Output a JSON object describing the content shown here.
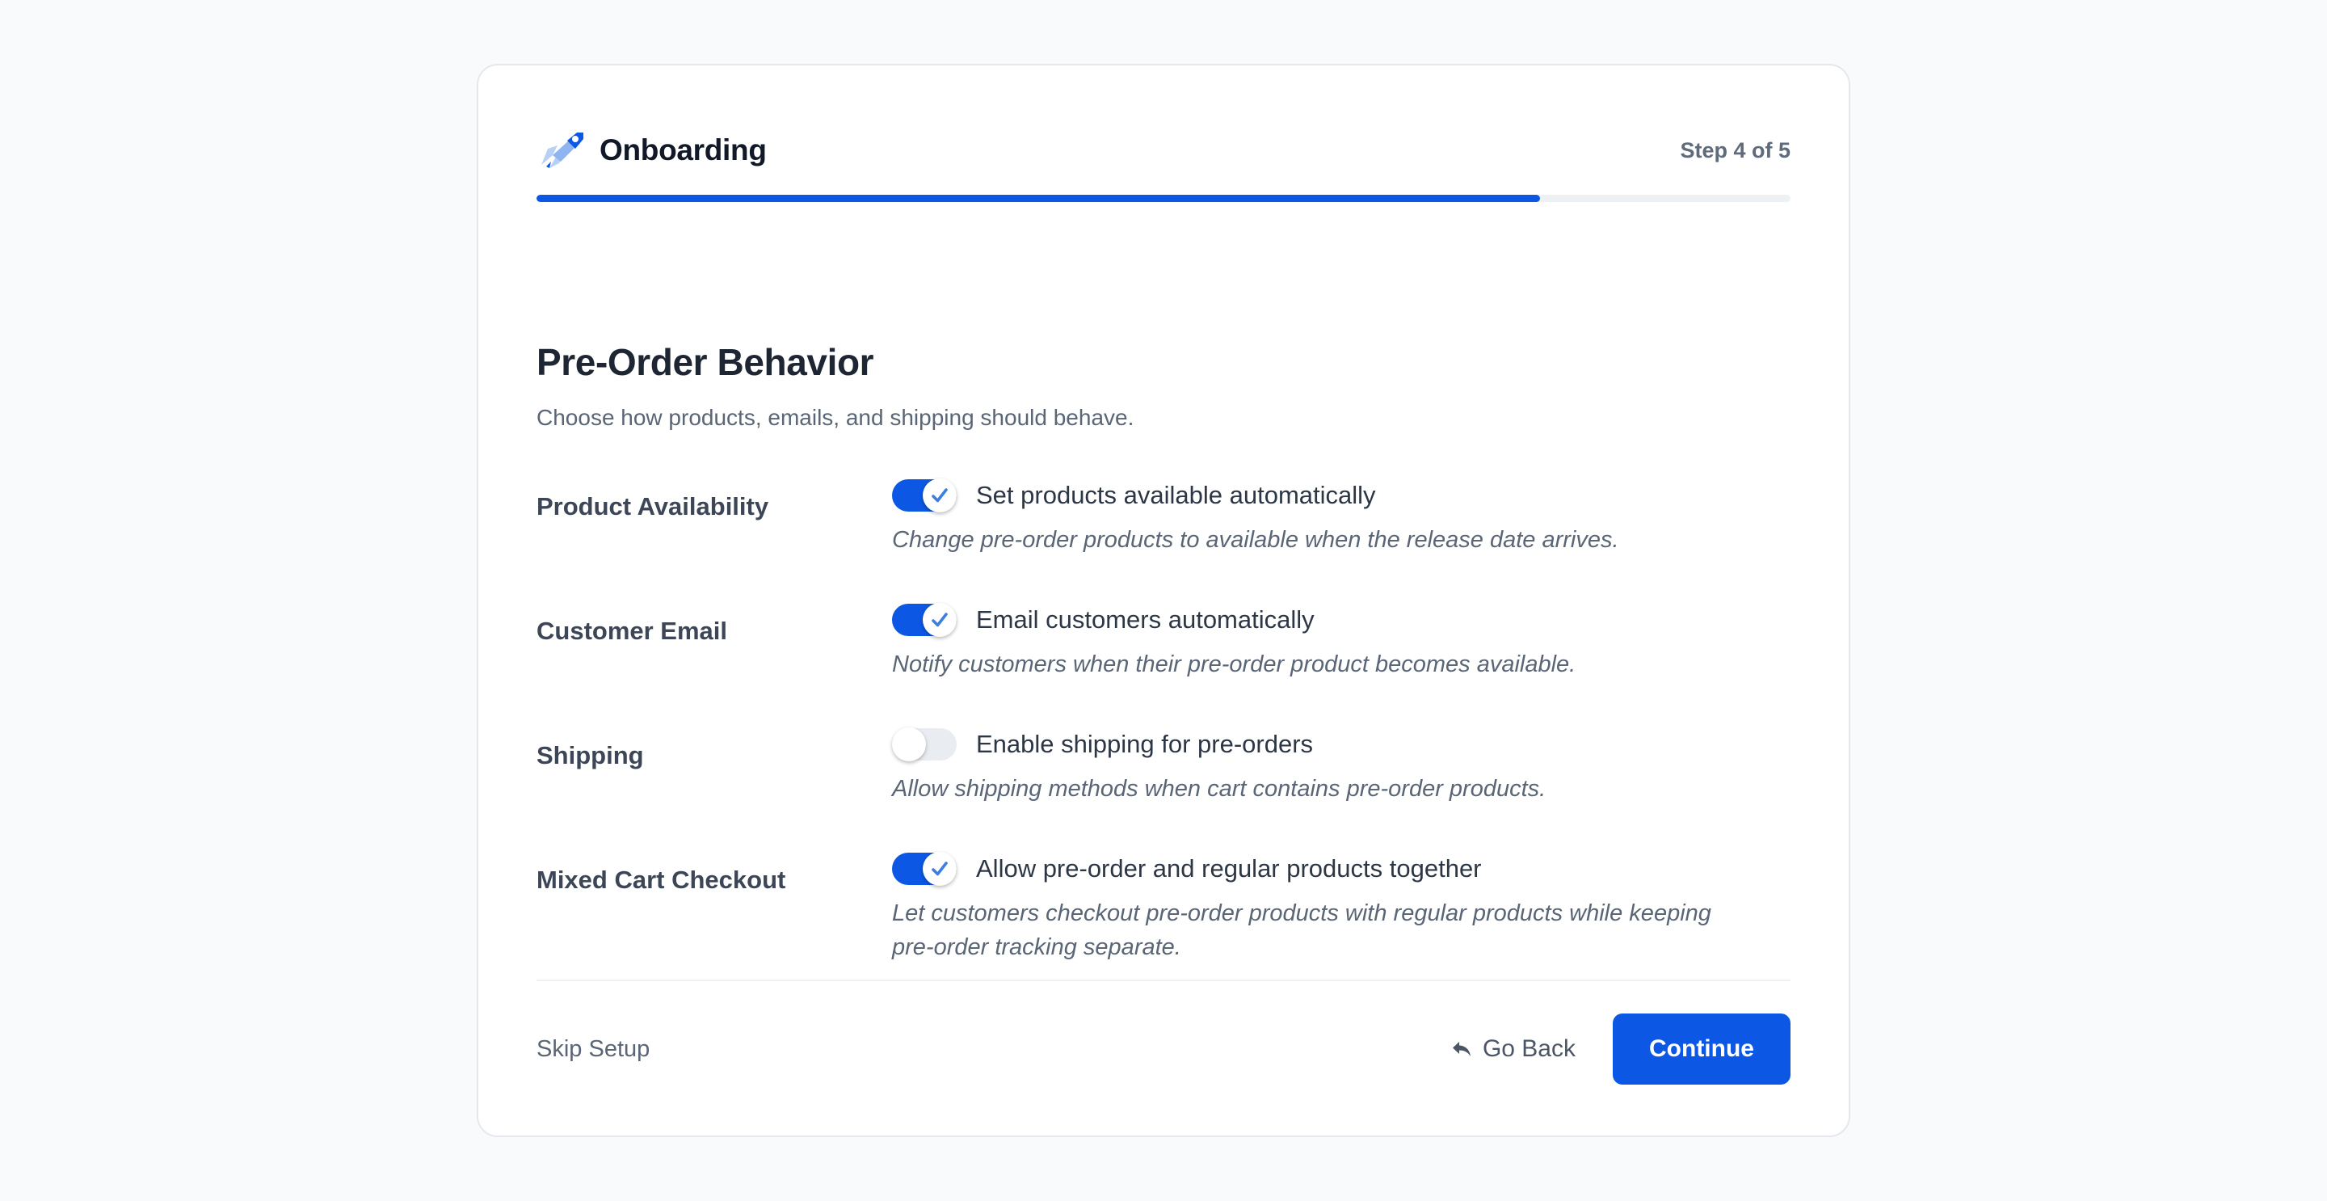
{
  "header": {
    "title": "Onboarding",
    "step": "Step 4 of 5",
    "logo_icon": "rocket-icon"
  },
  "progress": {
    "current_step": 4,
    "total_steps": 5,
    "fraction": 0.8
  },
  "section": {
    "title": "Pre-Order Behavior",
    "subtitle": "Choose how products, emails, and shipping should behave."
  },
  "settings": [
    {
      "label": "Product Availability",
      "toggle_label": "Set products available automatically",
      "description": "Change pre-order products to available when the release date arrives.",
      "enabled": true
    },
    {
      "label": "Customer Email",
      "toggle_label": "Email customers automatically",
      "description": "Notify customers when their pre-order product becomes available.",
      "enabled": true
    },
    {
      "label": "Shipping",
      "toggle_label": "Enable shipping for pre-orders",
      "description": "Allow shipping methods when cart contains pre-order products.",
      "enabled": false
    },
    {
      "label": "Mixed Cart Checkout",
      "toggle_label": "Allow pre-order and regular products together",
      "description": "Let customers checkout pre-order products with regular products while keeping pre-order tracking separate.",
      "enabled": true
    }
  ],
  "footer": {
    "skip_label": "Skip Setup",
    "back_label": "Go Back",
    "back_icon": "reply-arrow-icon",
    "continue_label": "Continue"
  },
  "colors": {
    "accent": "#0c57e4",
    "page_background": "#f9fafc",
    "card_background": "#ffffff",
    "toggle_off": "#e9ecf0"
  }
}
